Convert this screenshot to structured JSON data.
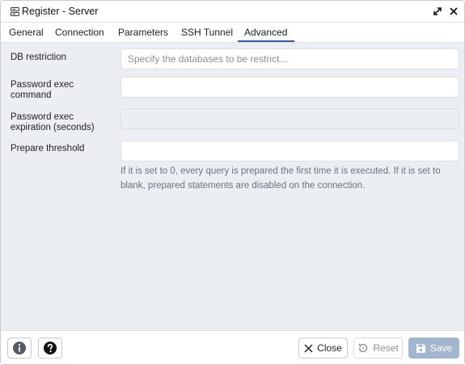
{
  "window": {
    "title": "Register - Server"
  },
  "tabs": [
    {
      "label": "General",
      "active": false
    },
    {
      "label": "Connection",
      "active": false
    },
    {
      "label": "Parameters",
      "active": false
    },
    {
      "label": "SSH Tunnel",
      "active": false
    },
    {
      "label": "Advanced",
      "active": true
    }
  ],
  "form": {
    "db_restriction": {
      "label": "DB restriction",
      "value": "",
      "placeholder": "Specify the databases to be restrict..."
    },
    "password_exec_command": {
      "label_line1": "Password exec",
      "label_line2": "command",
      "value": ""
    },
    "password_exec_expiration": {
      "label_line1": "Password exec",
      "label_line2": "expiration (seconds)",
      "value": "",
      "disabled": true
    },
    "prepare_threshold": {
      "label": "Prepare threshold",
      "value": "",
      "help": "If it is set to 0, every query is prepared the first time it is executed. If it is set to blank, prepared statements are disabled on the connection."
    }
  },
  "footer": {
    "info_icon": "info-icon",
    "help_icon": "help-icon",
    "close_label": "Close",
    "reset_label": "Reset",
    "save_label": "Save"
  },
  "colors": {
    "accent": "#3b5998",
    "save_disabled": "#a3b6cf",
    "panel_bg": "#ebeef3"
  }
}
